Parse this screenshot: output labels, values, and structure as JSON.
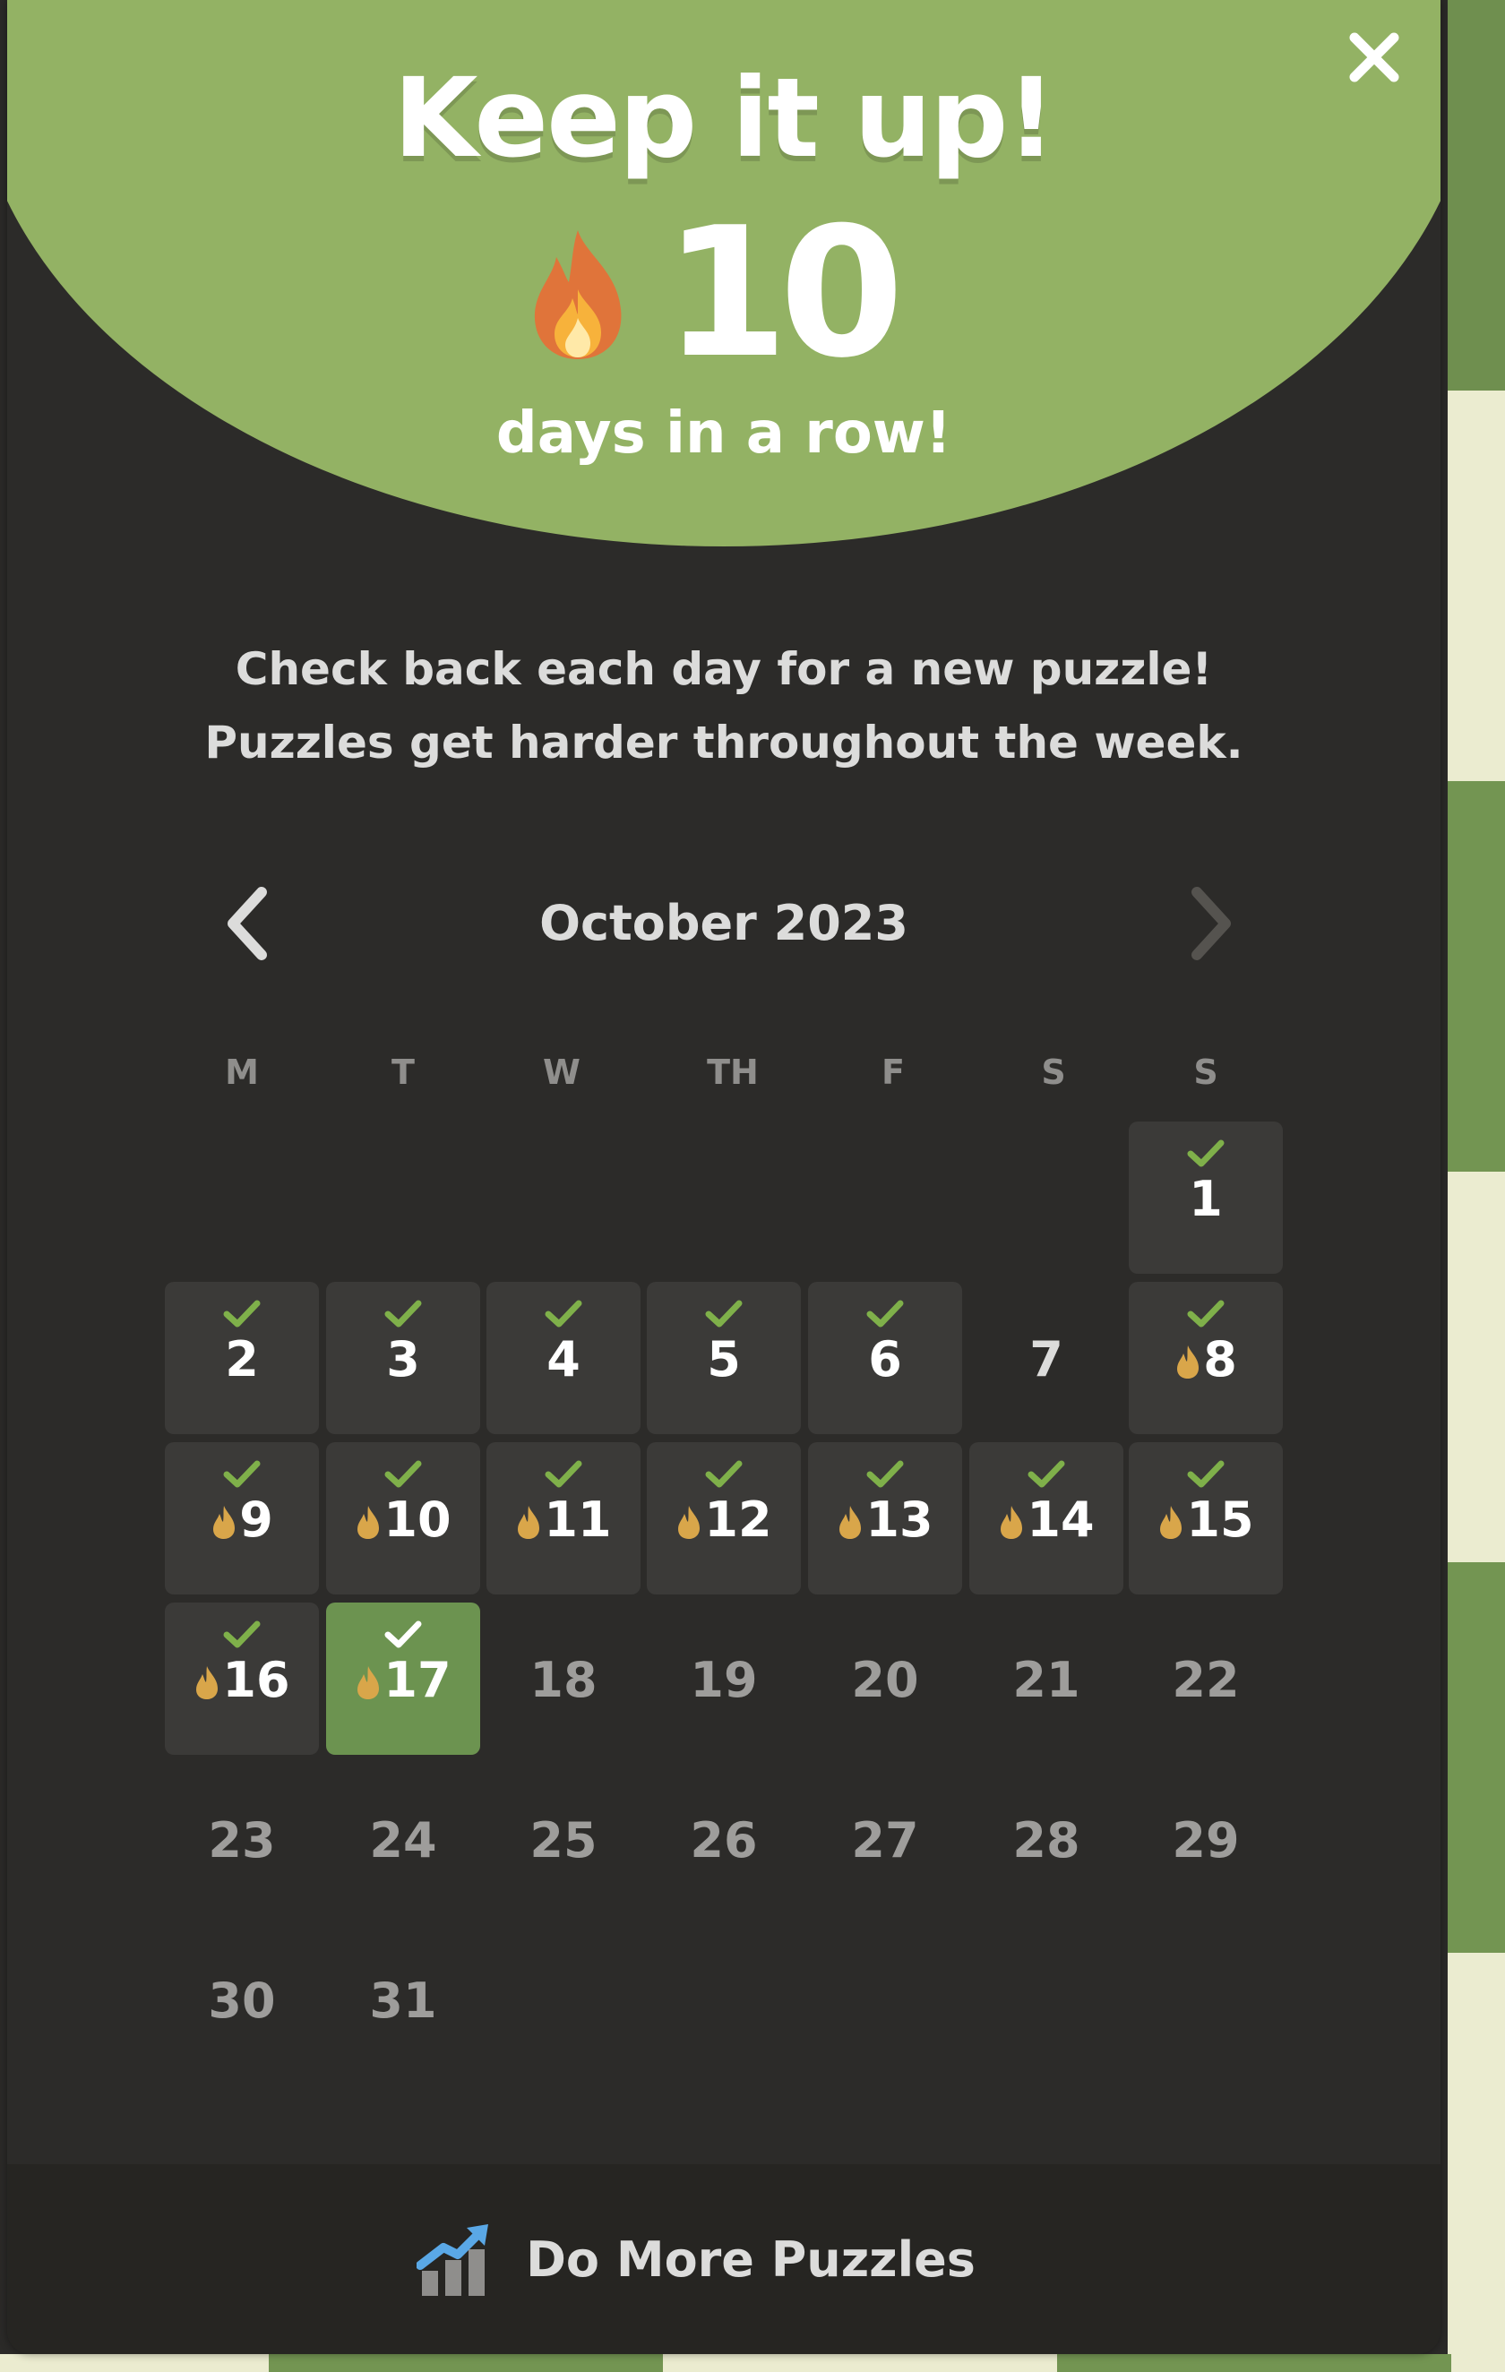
{
  "modal": {
    "title": "Keep it up!",
    "streak_count": "10",
    "streak_label": "days in a row!",
    "info_line_1": "Check back each day for a new puzzle!",
    "info_line_2": "Puzzles get harder throughout the week.",
    "close_icon": "close-icon"
  },
  "calendar": {
    "month_label": "October 2023",
    "prev_icon": "chevron-left-icon",
    "next_icon": "chevron-right-icon",
    "weekdays": [
      "M",
      "T",
      "W",
      "TH",
      "F",
      "S",
      "S"
    ],
    "days": [
      {
        "day": "1",
        "status": "done",
        "streak": false
      },
      {
        "day": "2",
        "status": "done",
        "streak": false
      },
      {
        "day": "3",
        "status": "done",
        "streak": false
      },
      {
        "day": "4",
        "status": "done",
        "streak": false
      },
      {
        "day": "5",
        "status": "done",
        "streak": false
      },
      {
        "day": "6",
        "status": "done",
        "streak": false
      },
      {
        "day": "7",
        "status": "missed",
        "streak": false
      },
      {
        "day": "8",
        "status": "done",
        "streak": true
      },
      {
        "day": "9",
        "status": "done",
        "streak": true
      },
      {
        "day": "10",
        "status": "done",
        "streak": true
      },
      {
        "day": "11",
        "status": "done",
        "streak": true
      },
      {
        "day": "12",
        "status": "done",
        "streak": true
      },
      {
        "day": "13",
        "status": "done",
        "streak": true
      },
      {
        "day": "14",
        "status": "done",
        "streak": true
      },
      {
        "day": "15",
        "status": "done",
        "streak": true
      },
      {
        "day": "16",
        "status": "done",
        "streak": true
      },
      {
        "day": "17",
        "status": "today",
        "streak": true
      },
      {
        "day": "18",
        "status": "future",
        "streak": false
      },
      {
        "day": "19",
        "status": "future",
        "streak": false
      },
      {
        "day": "20",
        "status": "future",
        "streak": false
      },
      {
        "day": "21",
        "status": "future",
        "streak": false
      },
      {
        "day": "22",
        "status": "future",
        "streak": false
      },
      {
        "day": "23",
        "status": "future",
        "streak": false
      },
      {
        "day": "24",
        "status": "future",
        "streak": false
      },
      {
        "day": "25",
        "status": "future",
        "streak": false
      },
      {
        "day": "26",
        "status": "future",
        "streak": false
      },
      {
        "day": "27",
        "status": "future",
        "streak": false
      },
      {
        "day": "28",
        "status": "future",
        "streak": false
      },
      {
        "day": "29",
        "status": "future",
        "streak": false
      },
      {
        "day": "30",
        "status": "future",
        "streak": false
      },
      {
        "day": "31",
        "status": "future",
        "streak": false
      }
    ]
  },
  "footer": {
    "button_label": "Do More Puzzles",
    "button_icon": "puzzle-stats-icon"
  },
  "colors": {
    "header_green": "#93b264",
    "modal_bg": "#2c2b29",
    "done_tile": "#3b3a38",
    "today_tile": "#6c9350",
    "check_green": "#7fb04a",
    "flame_gold": "#d9a64a"
  }
}
